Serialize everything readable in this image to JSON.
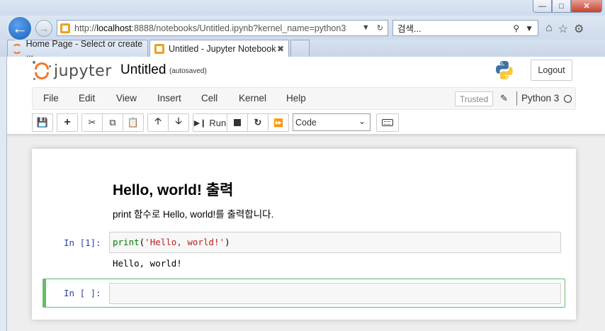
{
  "browser": {
    "address": {
      "prefix": "http://",
      "host": "localhost",
      "rest": ":8888/notebooks/Untitled.ipynb?kernel_name=python3"
    },
    "search_text": "검색...",
    "tabs": [
      {
        "label": "Home Page - Select or create ...",
        "active": false
      },
      {
        "label": "Untitled - Jupyter Notebook",
        "active": true
      }
    ],
    "icons": [
      "back-arrow-icon",
      "forward-arrow-icon",
      "refresh-icon",
      "search-icon",
      "home-icon",
      "star-icon",
      "gear-icon"
    ]
  },
  "header": {
    "logo_text": "jupyter",
    "notebook_name": "Untitled",
    "autosave_status": "(autosaved)",
    "logout_label": "Logout"
  },
  "menu": {
    "items": [
      "File",
      "Edit",
      "View",
      "Insert",
      "Cell",
      "Kernel",
      "Help"
    ],
    "trusted_label": "Trusted",
    "kernel_name": "Python 3"
  },
  "toolbar": {
    "run_label": "Run",
    "cell_type": "Code"
  },
  "notebook": {
    "markdown_heading": "Hello, world! 출력",
    "markdown_text": "print 함수로 Hello, world!를 출력합니다.",
    "cell1_prompt": "In [1]:",
    "cell1_code_fn": "print",
    "cell1_code_open": "(",
    "cell1_code_str": "'Hello, world!'",
    "cell1_code_close": ")",
    "cell1_output": "Hello, world!",
    "cell2_prompt": "In [ ]:"
  },
  "colors": {
    "jupyter_orange": "#f37726",
    "prompt_blue": "#303f9f",
    "selected_green": "#66bb6a",
    "string_red": "#ba2121",
    "keyword_green": "#008000"
  }
}
